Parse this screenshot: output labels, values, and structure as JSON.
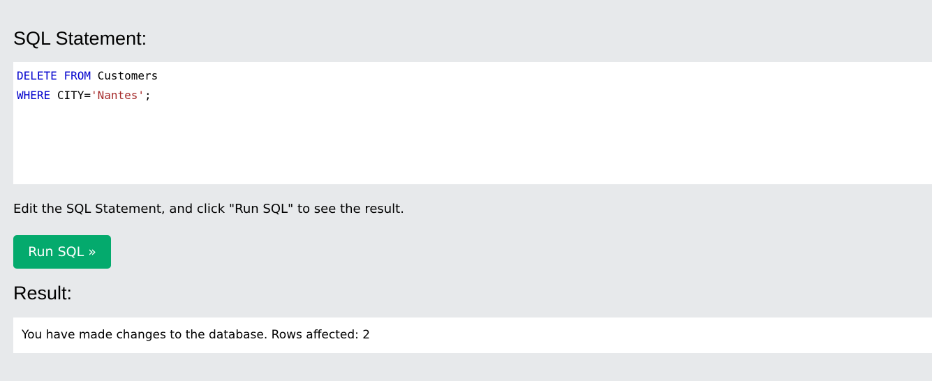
{
  "sql_section": {
    "heading": "SQL Statement:",
    "code_lines": [
      {
        "keyword1": "DELETE",
        "keyword2": "FROM",
        "identifier": "Customers"
      },
      {
        "keyword": "WHERE",
        "identifier": "CITY=",
        "string": "'Nantes'",
        "punct": ";"
      }
    ]
  },
  "instructions": "Edit the SQL Statement, and click \"Run SQL\" to see the result.",
  "run_button": {
    "label": "Run SQL »"
  },
  "result_section": {
    "heading": "Result:",
    "message": "You have made changes to the database. Rows affected: 2"
  },
  "colors": {
    "page_background": "#e7e9eb",
    "button_background": "#04aa6d",
    "keyword": "#0000cd",
    "string": "#a52a2a"
  }
}
